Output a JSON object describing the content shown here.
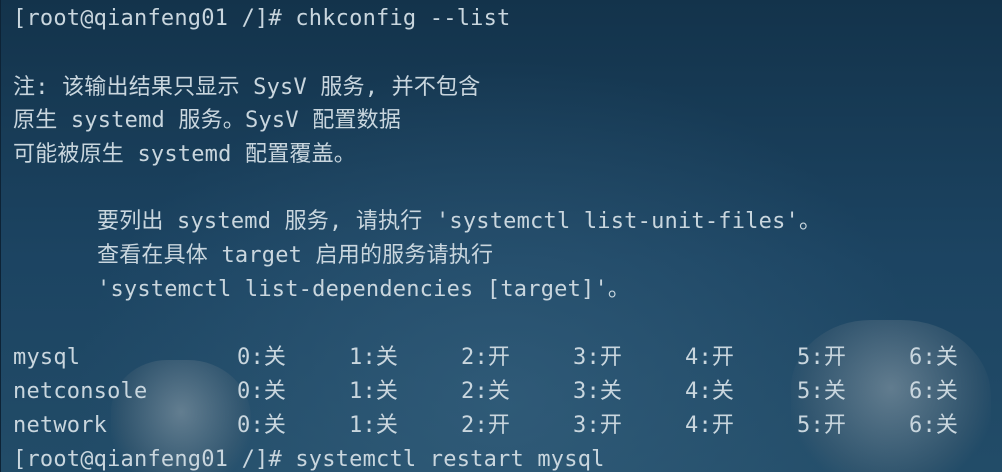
{
  "terminal": {
    "prompt1": "[root@qianfeng01 /]# chkconfig --list",
    "note_line1": "注: 该输出结果只显示 SysV 服务, 并不包含",
    "note_line2": "原生 systemd 服务。SysV 配置数据",
    "note_line3": "可能被原生 systemd 配置覆盖。",
    "hint_line1": "要列出 systemd 服务, 请执行 'systemctl list-unit-files'。",
    "hint_line2": "查看在具体 target 启用的服务请执行",
    "hint_line3": "'systemctl list-dependencies [target]'。",
    "services": [
      {
        "name": "mysql",
        "levels": [
          "0:关",
          "1:关",
          "2:开",
          "3:开",
          "4:开",
          "5:开",
          "6:关"
        ]
      },
      {
        "name": "netconsole",
        "levels": [
          "0:关",
          "1:关",
          "2:关",
          "3:关",
          "4:关",
          "5:关",
          "6:关"
        ]
      },
      {
        "name": "network",
        "levels": [
          "0:关",
          "1:关",
          "2:开",
          "3:开",
          "4:开",
          "5:开",
          "6:关"
        ]
      }
    ],
    "prompt2": "[root@qianfeng01 /]# systemctl restart mysql"
  }
}
